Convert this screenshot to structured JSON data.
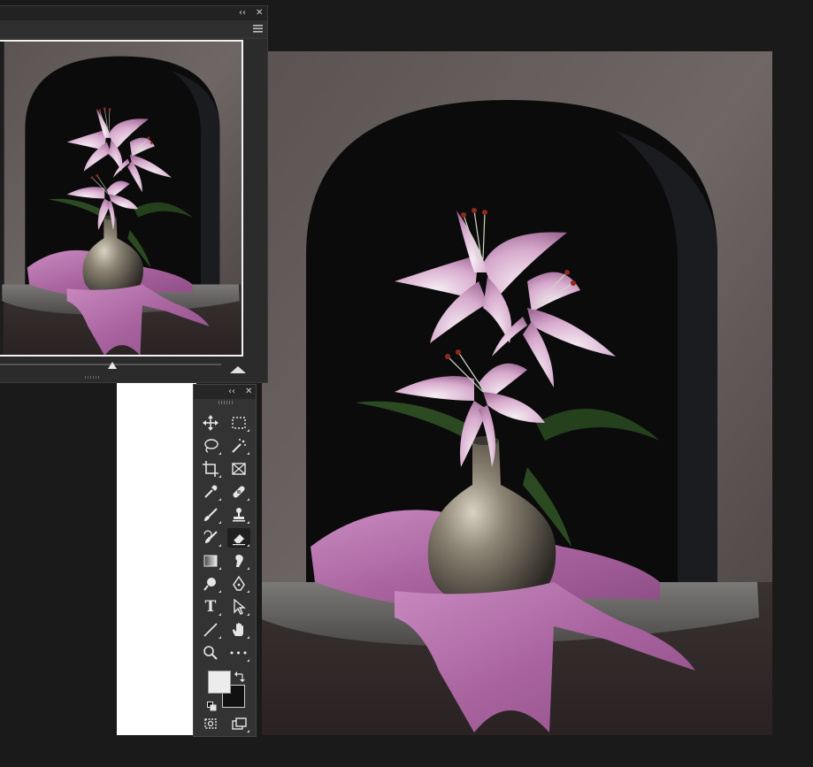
{
  "colors": {
    "workspace": "#1a1a1a",
    "panel": "#333333",
    "panel_header": "#262626",
    "foreground_color": "#ececec",
    "background_color": "#111111",
    "accent_lily": "#d6a6cc",
    "accent_cloth": "#b774b0"
  },
  "navigator": {
    "collapse_glyph": "‹‹",
    "close_glyph": "✕",
    "menu_icon": "panel-menu-icon"
  },
  "tools_panel": {
    "collapse_glyph": "‹‹",
    "close_glyph": "✕",
    "text_tool_glyph": "T",
    "more_tools_glyph": "•••",
    "tools": [
      "move-tool-icon",
      "rectangular-marquee-icon",
      "lasso-icon",
      "magic-wand-icon",
      "crop-icon",
      "frame-tool-icon",
      "eyedropper-icon",
      "healing-brush-icon",
      "brush-icon",
      "clone-stamp-icon",
      "history-brush-icon",
      "eraser-icon",
      "gradient-icon",
      "smudge-icon",
      "dodge-icon",
      "pen-icon",
      "type-icon",
      "path-selection-icon",
      "line-tool-icon",
      "hand-icon",
      "zoom-icon",
      "more-tools-icon",
      "quick-mask-icon",
      "screen-mode-icon"
    ],
    "active_tool": "eraser-icon"
  }
}
